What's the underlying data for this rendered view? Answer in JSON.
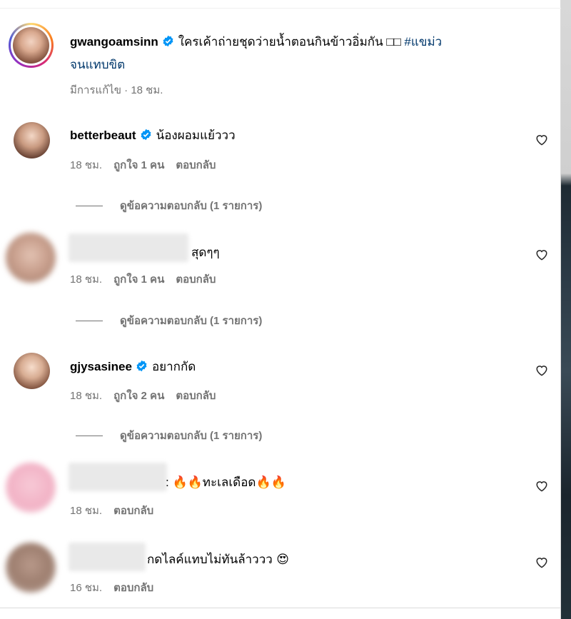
{
  "post": {
    "username": "gwangoamsinn",
    "caption": "ใครเค้าถ่ายชุดว่ายน้ำตอนกินข้าวอิ่มกัน □□",
    "hashtag_line1": "#แขม่ว",
    "hashtag_line2": "จนแทบขิต",
    "edited": "มีการแก้ไข · 18 ชม."
  },
  "comments": [
    {
      "username": "betterbeaut",
      "verified": true,
      "text": "น้องผอมแย้ววว",
      "time": "18 ชม.",
      "likes": "ถูกใจ 1 คน",
      "reply": "ตอบกลับ",
      "view_replies": "ดูข้อความตอบกลับ (1 รายการ)"
    },
    {
      "username": "",
      "verified": false,
      "text": "สุดๆๆ",
      "time": "18 ชม.",
      "likes": "ถูกใจ 1 คน",
      "reply": "ตอบกลับ",
      "view_replies": "ดูข้อความตอบกลับ (1 รายการ)"
    },
    {
      "username": "gjysasinee",
      "verified": true,
      "text": "อยากกัด",
      "time": "18 ชม.",
      "likes": "ถูกใจ 2 คน",
      "reply": "ตอบกลับ",
      "view_replies": "ดูข้อความตอบกลับ (1 รายการ)"
    },
    {
      "username": "",
      "verified": false,
      "text_prefix": ": ",
      "text": "🔥🔥ทะเลเดือด🔥🔥",
      "time": "18 ชม.",
      "reply": "ตอบกลับ"
    },
    {
      "username": "",
      "verified": false,
      "text": "กดไลค์แทบไม่ทันล้าววว 😍",
      "time": "16 ชม.",
      "reply": "ตอบกลับ"
    }
  ],
  "colors": {
    "text": "#000000",
    "meta": "#737373",
    "verified": "#0095f6",
    "link": "#00376b"
  },
  "icons": {
    "verified": "verified-badge-icon",
    "heart": "heart-outline-icon"
  }
}
